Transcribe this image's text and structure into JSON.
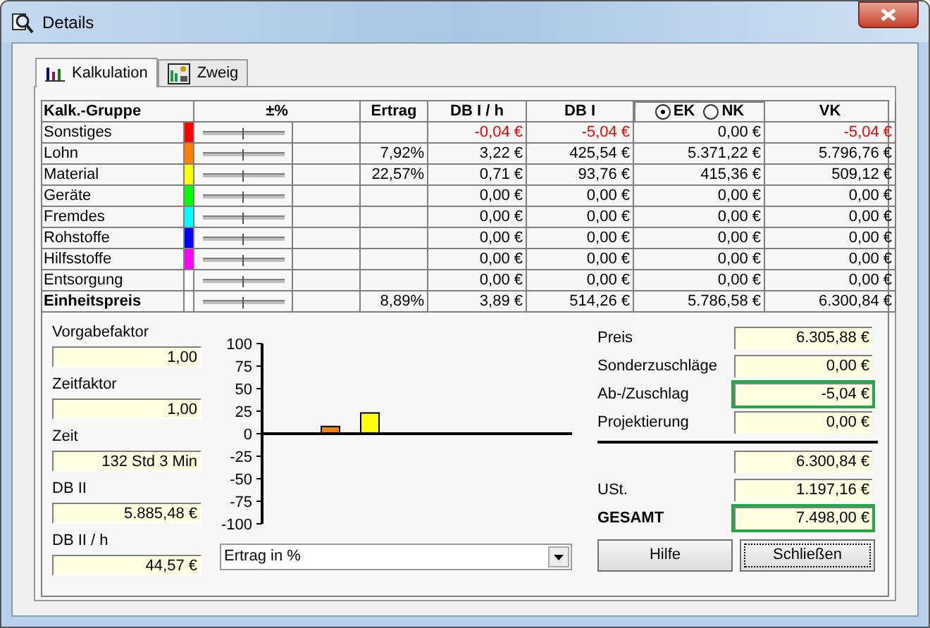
{
  "window": {
    "title": "Details"
  },
  "tabs": [
    {
      "label": "Kalkulation",
      "selected": true
    },
    {
      "label": "Zweig",
      "selected": false
    }
  ],
  "table": {
    "columns": [
      "Kalk.-Gruppe",
      "±%",
      "Ertrag",
      "DB I / h",
      "DB I",
      "VK"
    ],
    "cost_basis": [
      {
        "label": "EK",
        "selected": true
      },
      {
        "label": "NK",
        "selected": false
      }
    ],
    "rows": [
      {
        "group": "Sonstiges",
        "color": "#ff0000",
        "level": 0.5,
        "kind": "normal",
        "negative": true,
        "db_h": "-0,04 €",
        "db": "-5,04 €",
        "ek": "0,00 €",
        "vk": "-5,04 €"
      },
      {
        "group": "Lohn",
        "color": "#ff8000",
        "level": 0.5,
        "kind": "normal",
        "negative": false,
        "ertrag": "7,92%",
        "db_h": "3,22 €",
        "db": "425,54 €",
        "ek": "5.371,22 €",
        "vk": "5.796,76 €"
      },
      {
        "group": "Material",
        "color": "#ffff00",
        "level": 0.5,
        "kind": "normal",
        "negative": false,
        "ertrag": "22,57%",
        "db_h": "0,71 €",
        "db": "93,76 €",
        "ek": "415,36 €",
        "vk": "509,12 €"
      },
      {
        "group": "Geräte",
        "color": "#00ff00",
        "level": 0.5,
        "kind": "normal",
        "negative": false,
        "db_h": "0,00 €",
        "db": "0,00 €",
        "ek": "0,00 €",
        "vk": "0,00 €"
      },
      {
        "group": "Fremdes",
        "color": "#00ffff",
        "level": 0.5,
        "kind": "normal",
        "negative": false,
        "db_h": "0,00 €",
        "db": "0,00 €",
        "ek": "0,00 €",
        "vk": "0,00 €"
      },
      {
        "group": "Rohstoffe",
        "color": "#0000ff",
        "level": 0.5,
        "kind": "normal",
        "negative": false,
        "db_h": "0,00 €",
        "db": "0,00 €",
        "ek": "0,00 €",
        "vk": "0,00 €"
      },
      {
        "group": "Hilfsstoffe",
        "color": "#ff00ff",
        "level": 0.5,
        "kind": "normal",
        "negative": false,
        "db_h": "0,00 €",
        "db": "0,00 €",
        "ek": "0,00 €",
        "vk": "0,00 €"
      },
      {
        "group": "Entsorgung",
        "color": "#ffffff",
        "level": 0.5,
        "kind": "normal",
        "negative": false,
        "db_h": "0,00 €",
        "db": "0,00 €",
        "ek": "0,00 €",
        "vk": "0,00 €"
      },
      {
        "group": "Einheitspreis",
        "color": "#ffffff",
        "level": 0.5,
        "kind": "total",
        "negative": false,
        "ertrag": "8,89%",
        "db_h": "3,89 €",
        "db": "514,26 €",
        "ek": "5.786,58 €",
        "vk": "6.300,84 €"
      }
    ]
  },
  "factors": [
    {
      "label": "Vorgabefaktor",
      "value": "1,00"
    },
    {
      "label": "Zeitfaktor",
      "value": "1,00"
    },
    {
      "label": "Zeit",
      "value": "132 Std 3 Min"
    },
    {
      "label": "DB II",
      "value": "5.885,48 €"
    },
    {
      "label": "DB II / h",
      "value": "44,57 €"
    }
  ],
  "chart": {
    "chart_data": {
      "type": "bar",
      "ylim": [
        -100,
        100
      ],
      "yticks": [
        100,
        75,
        50,
        25,
        0,
        -25,
        -50,
        -75,
        -100
      ],
      "series": [
        {
          "values": [
            null,
            8,
            23,
            null,
            null,
            null,
            null,
            null
          ]
        }
      ]
    },
    "dropdown": {
      "value": "Ertrag in %"
    }
  },
  "totals": [
    {
      "label": "Preis",
      "value": "6.305,88 €",
      "kind": "normal",
      "highlighted": false
    },
    {
      "label": "Sonderzuschläge",
      "value": "0,00 €",
      "kind": "normal",
      "highlighted": false
    },
    {
      "label": "Ab-/Zuschlag",
      "value": "-5,04 €",
      "kind": "normal",
      "highlighted": true
    },
    {
      "label": "Projektierung",
      "value": "0,00 €",
      "kind": "normal",
      "highlighted": false
    },
    {
      "value": "6.300,84 €",
      "kind": "subtotal",
      "highlighted": false
    },
    {
      "label": "USt.",
      "value": "1.197,16 €",
      "kind": "normal",
      "highlighted": false
    },
    {
      "label": "GESAMT",
      "value": "7.498,00 €",
      "kind": "total",
      "highlighted": true
    }
  ],
  "buttons": [
    {
      "label": "Hilfe",
      "focused": false
    },
    {
      "label": "Schließen",
      "focused": true
    }
  ]
}
